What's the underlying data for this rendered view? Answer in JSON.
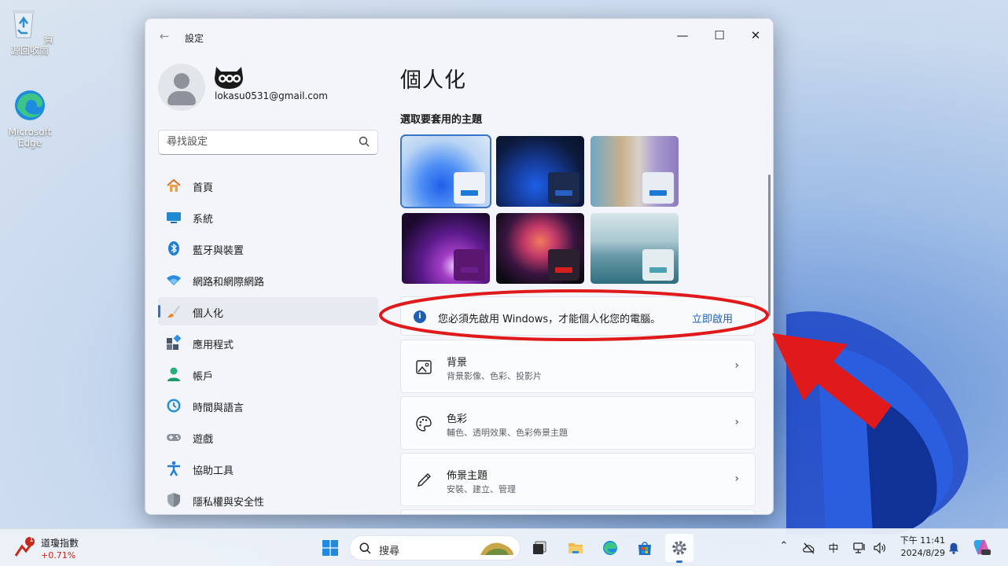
{
  "desktop": {
    "icons": [
      {
        "label": "資源回收筒"
      },
      {
        "label": "Microsoft Edge"
      }
    ]
  },
  "window": {
    "title": "設定",
    "controls": {
      "minimize": "—",
      "maximize": "☐",
      "close": "✕"
    }
  },
  "account": {
    "email": "lokasu0531@gmail.com"
  },
  "search": {
    "placeholder": "尋找設定"
  },
  "sidebar": {
    "items": [
      {
        "label": "首頁",
        "icon": "home-icon"
      },
      {
        "label": "系統",
        "icon": "system-icon"
      },
      {
        "label": "藍牙與裝置",
        "icon": "bluetooth-icon"
      },
      {
        "label": "網路和網際網路",
        "icon": "wifi-icon"
      },
      {
        "label": "個人化",
        "icon": "brush-icon",
        "active": true
      },
      {
        "label": "應用程式",
        "icon": "apps-icon"
      },
      {
        "label": "帳戶",
        "icon": "account-icon"
      },
      {
        "label": "時間與語言",
        "icon": "time-language-icon"
      },
      {
        "label": "遊戲",
        "icon": "gamepad-icon"
      },
      {
        "label": "協助工具",
        "icon": "accessibility-icon"
      },
      {
        "label": "隱私權與安全性",
        "icon": "shield-icon"
      }
    ]
  },
  "main": {
    "title": "個人化",
    "themes_heading": "選取要套用的主題",
    "notice": {
      "text": "您必須先啟用 Windows，才能個人化您的電腦。",
      "link": "立即啟用"
    },
    "cards": [
      {
        "title": "背景",
        "subtitle": "背景影像、色彩、投影片",
        "icon": "picture-icon"
      },
      {
        "title": "色彩",
        "subtitle": "輔色、透明效果、色彩佈景主題",
        "icon": "palette-icon"
      },
      {
        "title": "佈景主題",
        "subtitle": "安裝、建立、管理",
        "icon": "pen-icon"
      }
    ]
  },
  "taskbar": {
    "widget": {
      "title": "道瓊指數",
      "value": "+0.71%",
      "badge": "1"
    },
    "search_label": "搜尋",
    "tray": {
      "input_method": "中"
    },
    "clock": {
      "time": "下午 11:41",
      "date": "2024/8/29"
    }
  },
  "colors": {
    "accent": "#2f6fd0",
    "annotation_red": "#e01a1a"
  }
}
